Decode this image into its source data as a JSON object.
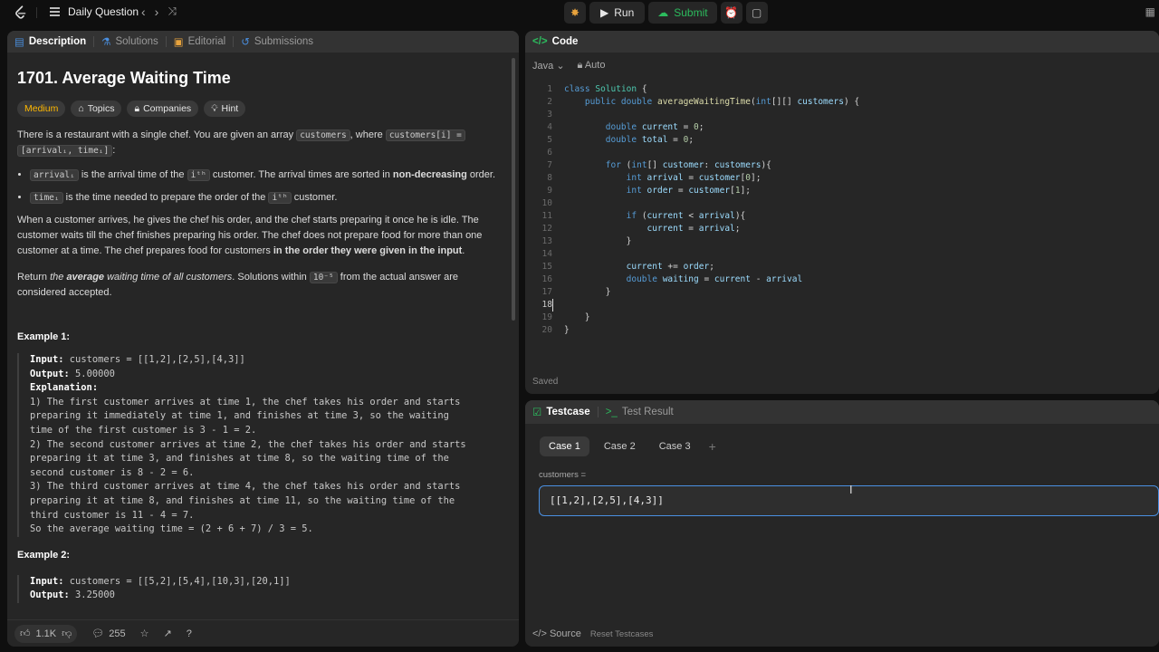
{
  "topbar": {
    "title": "Daily Question",
    "run_label": "Run",
    "submit_label": "Submit"
  },
  "left_tabs": [
    {
      "label": "Description"
    },
    {
      "label": "Solutions"
    },
    {
      "label": "Editorial"
    },
    {
      "label": "Submissions"
    }
  ],
  "problem": {
    "title": "1701. Average Waiting Time",
    "difficulty": "Medium",
    "tag_topics": "Topics",
    "tag_companies": "Companies",
    "tag_hint": "Hint",
    "p1_a": "There is a restaurant with a single chef. You are given an array ",
    "p1_code1": "customers",
    "p1_b": ", where ",
    "p1_code2": "customers[i] =",
    "p1_code3": "[arrivalᵢ, timeᵢ]",
    "p1_c": ":",
    "b1_code": "arrivalᵢ",
    "b1_a": " is the arrival time of the ",
    "b1_code2": "iᵗʰ",
    "b1_b": " customer. The arrival times are sorted in ",
    "b1_bold": "non-decreasing",
    "b1_c": " order.",
    "b2_code": "timeᵢ",
    "b2_a": " is the time needed to prepare the order of the ",
    "b2_code2": "iᵗʰ",
    "b2_b": " customer.",
    "p2_a": "When a customer arrives, he gives the chef his order, and the chef starts preparing it once he is idle. The customer waits till the chef finishes preparing his order. The chef does not prepare food for more than one customer at a time. The chef prepares food for customers ",
    "p2_bold": "in the order they were given in the input",
    "p2_b": ".",
    "p3_a": "Return ",
    "p3_em1": "the ",
    "p3_bold": "average",
    "p3_em2": " waiting time of all customers",
    "p3_b": ". Solutions within ",
    "p3_code": "10⁻⁵",
    "p3_c": " from the actual answer are considered accepted.",
    "ex1_title": "Example 1:",
    "ex1_input_label": "Input:",
    "ex1_input": " customers = [[1,2],[2,5],[4,3]]",
    "ex1_output_label": "Output:",
    "ex1_output": " 5.00000",
    "ex1_expl_label": "Explanation:",
    "ex1_lines": [
      "1) The first customer arrives at time 1, the chef takes his order and starts",
      "preparing it immediately at time 1, and finishes at time 3, so the waiting",
      "time of the first customer is 3 - 1 = 2.",
      "2) The second customer arrives at time 2, the chef takes his order and starts",
      "preparing it at time 3, and finishes at time 8, so the waiting time of the",
      "second customer is 8 - 2 = 6.",
      "3) The third customer arrives at time 4, the chef takes his order and starts",
      "preparing it at time 8, and finishes at time 11, so the waiting time of the",
      "third customer is 11 - 4 = 7.",
      "So the average waiting time = (2 + 6 + 7) / 3 = 5."
    ],
    "ex2_title": "Example 2:",
    "ex2_input_label": "Input:",
    "ex2_input": " customers = [[5,2],[5,4],[10,3],[20,1]]",
    "ex2_output_label": "Output:",
    "ex2_output": " 3.25000"
  },
  "footer": {
    "likes": "1.1K",
    "comments": "255"
  },
  "code_panel": {
    "tab_label": "Code",
    "language": "Java",
    "mode": "Auto",
    "saved": "Saved"
  },
  "test_panel": {
    "tab_testcase": "Testcase",
    "tab_result": "Test Result",
    "cases": [
      "Case 1",
      "Case 2",
      "Case 3"
    ],
    "var_label": "customers =",
    "input_value": "[[1,2],[2,5],[4,3]]",
    "source_label": "Source",
    "reset_label": "Reset Testcases"
  }
}
